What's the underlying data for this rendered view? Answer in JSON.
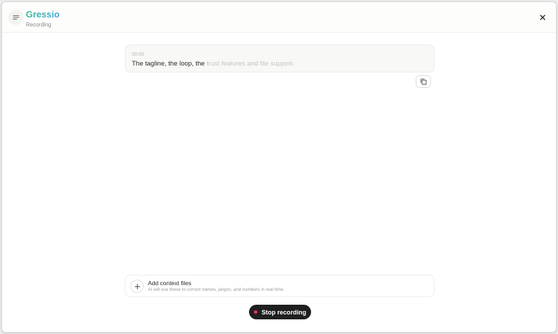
{
  "app": {
    "name": "Gressio",
    "status": "Recording",
    "brand_gradient": [
      "#33b89a",
      "#45a8d6"
    ]
  },
  "header": {
    "menu_icon": "menu-icon",
    "close_icon": "close-icon"
  },
  "transcript": {
    "timestamp": "00:00",
    "spoken_text": "The tagline, the loop, the",
    "pending_text": "trust features and file support",
    "copy_icon": "copy-icon"
  },
  "context_files": {
    "title": "Add context files",
    "hint": "AI will use these to correct names, jargon, and numbers in real time.",
    "add_icon": "plus-icon"
  },
  "recording_control": {
    "label": "Stop recording",
    "indicator_color": "#e33b4c",
    "button_color": "#1f1f1f"
  }
}
